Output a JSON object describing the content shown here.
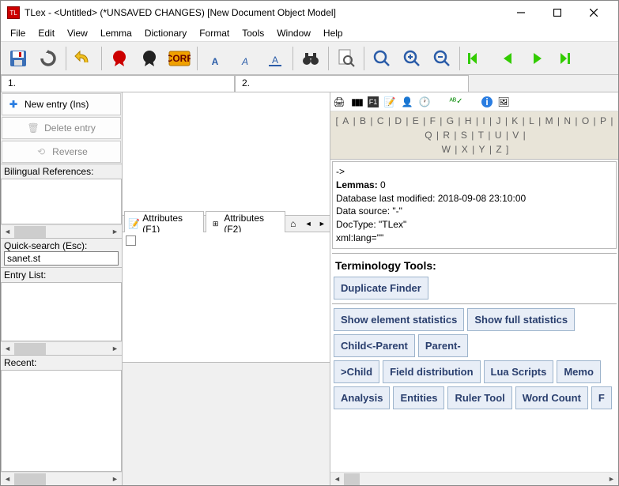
{
  "window": {
    "title": "TLex - <Untitled> (*UNSAVED CHANGES) [New Document Object Model]"
  },
  "menu": {
    "file": "File",
    "edit": "Edit",
    "view": "View",
    "lemma": "Lemma",
    "dictionary": "Dictionary",
    "format": "Format",
    "tools": "Tools",
    "window": "Window",
    "help": "Help"
  },
  "tabs": {
    "t1": "1.",
    "t2": "2."
  },
  "left": {
    "new_entry": "New entry (Ins)",
    "delete_entry": "Delete entry",
    "reverse": "Reverse",
    "biling_refs": "Bilingual References:",
    "quick_search": "Quick-search (Esc):",
    "search_value": "sanet.st",
    "entry_list": "Entry List:",
    "recent": "Recent:"
  },
  "attrs": {
    "f1": "Attributes (F1)",
    "f2": "Attributes (F2)"
  },
  "alpha": {
    "letters": [
      "A",
      "B",
      "C",
      "D",
      "E",
      "F",
      "G",
      "H",
      "I",
      "J",
      "K",
      "L",
      "M",
      "N",
      "O",
      "P",
      "Q",
      "R",
      "S",
      "T",
      "U",
      "V"
    ],
    "row2": [
      "W",
      "X",
      "Y",
      "Z"
    ]
  },
  "info": {
    "arrow": "->",
    "lemmas_label": "Lemmas:",
    "lemmas_count": "0",
    "db_mod": "Database last modified: 2018-09-08 23:10:00",
    "data_source": "Data source: \"-\"",
    "doctype": "DocType: \"TLex\"",
    "xmllang": "xml:lang=\"\""
  },
  "tools": {
    "heading": "Terminology Tools:",
    "dup_finder": "Duplicate Finder",
    "show_elem_stats": "Show element statistics",
    "show_full_stats": "Show full statistics",
    "child_parent": "Child<-Parent",
    "parent": "Parent-",
    "to_child": ">Child",
    "field_dist": "Field distribution",
    "lua": "Lua Scripts",
    "memo": "Memo",
    "analysis": "Analysis",
    "entities": "Entities",
    "ruler": "Ruler Tool",
    "word_count": "Word Count",
    "f": "F"
  }
}
